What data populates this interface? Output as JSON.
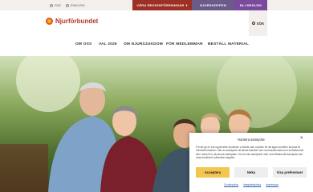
{
  "topbar": {
    "lang_sv": "SVE",
    "lang_en": "ENGLISH",
    "regions_label": "VÅRA REGIONFÖRENINGAR",
    "regions_chevron": "▾",
    "store_label": "NJURSHOPPEN",
    "member_label": "BLI MEDLEM"
  },
  "header": {
    "logo_text": "Njurförbundet",
    "search_label": "SÖK"
  },
  "nav": {
    "items": [
      "OM OSS",
      "VAL 2026",
      "OM NJURSJUKDOM",
      "FÖR MEDLEMMAR",
      "BESTÄLL MATERIAL"
    ]
  },
  "cookie": {
    "title": "Hantera samtycke",
    "close": "×",
    "text": "För att ge en bra upplevelse använder vi teknik som cookies för att lagra och/eller komma åt enhetsinformation. När du samtycker till dessa tekniker kan vi behandla data som surfbeteende eller unika ID:n på denna webbplats. Om du inte samtycker eller drar tillbaka ditt samtycke kan vissa funktioner påverkas negativt.",
    "accept": "Acceptera",
    "deny": "Neka",
    "preferences": "Visa preferenser",
    "links": [
      "Cookiepolicy",
      "Integritetspolicy",
      "Impressum"
    ]
  },
  "colors": {
    "brand_red": "#b4382a",
    "regions_bg": "#9e2f24",
    "store_bg": "#6b5a8a",
    "member_bg": "#7a4a9c",
    "accept_bg": "#f3c64f"
  }
}
